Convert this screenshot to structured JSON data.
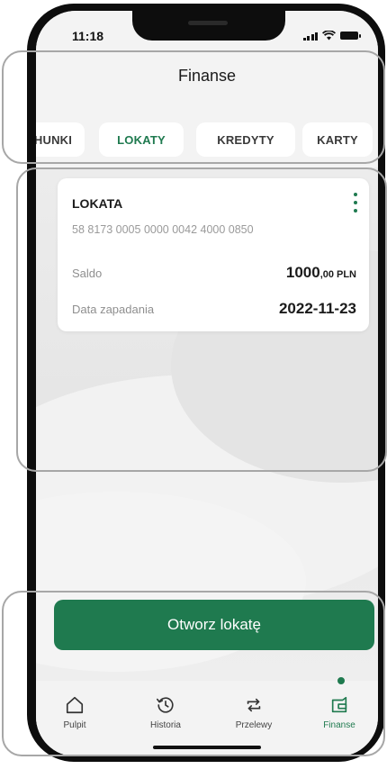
{
  "status": {
    "time": "11:18"
  },
  "header": {
    "title": "Finanse"
  },
  "tabs": [
    {
      "label": "HUNKI",
      "active": false
    },
    {
      "label": "LOKATY",
      "active": true
    },
    {
      "label": "KREDYTY",
      "active": false
    },
    {
      "label": "KARTY",
      "active": false
    }
  ],
  "card": {
    "title": "LOKATA",
    "account_number": "58 8173 0005 0000 0042 4000 0850",
    "rows": [
      {
        "label": "Saldo",
        "value": "1000",
        "value_decimals": ",00",
        "currency": "PLN"
      },
      {
        "label": "Data zapadania",
        "value": "2022-11-23"
      }
    ],
    "menu_icon": "more-vertical-icon"
  },
  "cta": {
    "label": "Otworz lokatę"
  },
  "bottom_nav": [
    {
      "label": "Pulpit",
      "icon": "home-icon",
      "active": false
    },
    {
      "label": "Historia",
      "icon": "history-icon",
      "active": false
    },
    {
      "label": "Przelewy",
      "icon": "transfer-icon",
      "active": false
    },
    {
      "label": "Finanse",
      "icon": "wallet-icon",
      "active": true
    }
  ],
  "colors": {
    "accent": "#1f7a4f",
    "background": "#efefef",
    "card": "#ffffff"
  }
}
